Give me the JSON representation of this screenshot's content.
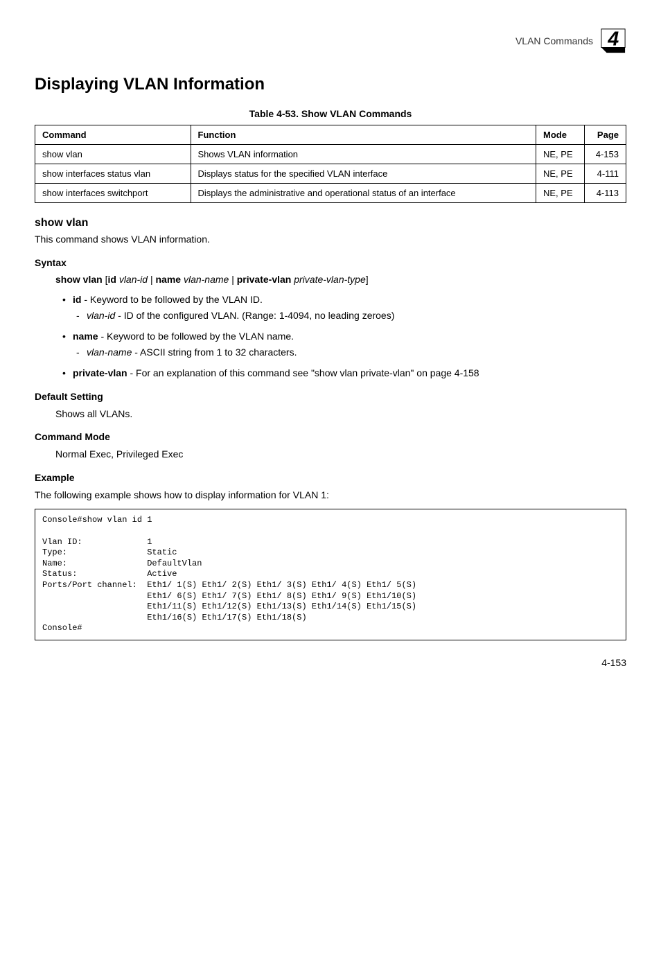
{
  "header": {
    "text": "VLAN Commands"
  },
  "title": "Displaying VLAN Information",
  "table": {
    "caption": "Table 4-53.   Show VLAN Commands",
    "headers": [
      "Command",
      "Function",
      "Mode",
      "Page"
    ],
    "rows": [
      {
        "cmd": "show vlan",
        "func": "Shows VLAN information",
        "mode": "NE, PE",
        "page": "4-153"
      },
      {
        "cmd": "show interfaces status vlan",
        "func": "Displays status for the specified VLAN interface",
        "mode": "NE, PE",
        "page": "4-111"
      },
      {
        "cmd": "show interfaces switchport",
        "func": "Displays the administrative and operational status of an interface",
        "mode": "NE, PE",
        "page": "4-113"
      }
    ]
  },
  "section1": {
    "heading": "show vlan",
    "desc": "This command shows VLAN information."
  },
  "syntax": {
    "heading": "Syntax",
    "line_parts": {
      "p1": "show vlan",
      "p2": " [",
      "p3": "id",
      "p4": " ",
      "p5": "vlan-id",
      "p6": " | ",
      "p7": "name",
      "p8": " ",
      "p9": "vlan-name",
      "p10": " | ",
      "p11": "private-vlan",
      "p12": " ",
      "p13": "private-vlan-type",
      "p14": "]"
    },
    "bullets": [
      {
        "prefix_bold": "id",
        "text": " - Keyword to be followed by the VLAN ID.",
        "sub": [
          {
            "prefix_italic": "vlan-id",
            "text": " - ID of the configured VLAN. (Range: 1-4094, no leading zeroes)"
          }
        ]
      },
      {
        "prefix_bold": "name",
        "text": " - Keyword to be followed by the VLAN name.",
        "sub": [
          {
            "prefix_italic": "vlan-name",
            "text": " - ASCII string from 1 to 32 characters."
          }
        ]
      },
      {
        "prefix_bold": "private-vlan",
        "text": " - For an explanation of this command see \"show vlan private-vlan\" on page 4-158",
        "sub": []
      }
    ]
  },
  "default_setting": {
    "heading": "Default Setting",
    "text": "Shows all VLANs."
  },
  "command_mode": {
    "heading": "Command Mode",
    "text": "Normal Exec, Privileged Exec"
  },
  "example": {
    "heading": "Example",
    "desc": "The following example shows how to display information for VLAN 1:",
    "code": "Console#show vlan id 1\n\nVlan ID:             1\nType:                Static\nName:                DefaultVlan\nStatus:              Active\nPorts/Port channel:  Eth1/ 1(S) Eth1/ 2(S) Eth1/ 3(S) Eth1/ 4(S) Eth1/ 5(S)\n                     Eth1/ 6(S) Eth1/ 7(S) Eth1/ 8(S) Eth1/ 9(S) Eth1/10(S)\n                     Eth1/11(S) Eth1/12(S) Eth1/13(S) Eth1/14(S) Eth1/15(S)\n                     Eth1/16(S) Eth1/17(S) Eth1/18(S)\nConsole#"
  },
  "page_number": "4-153"
}
